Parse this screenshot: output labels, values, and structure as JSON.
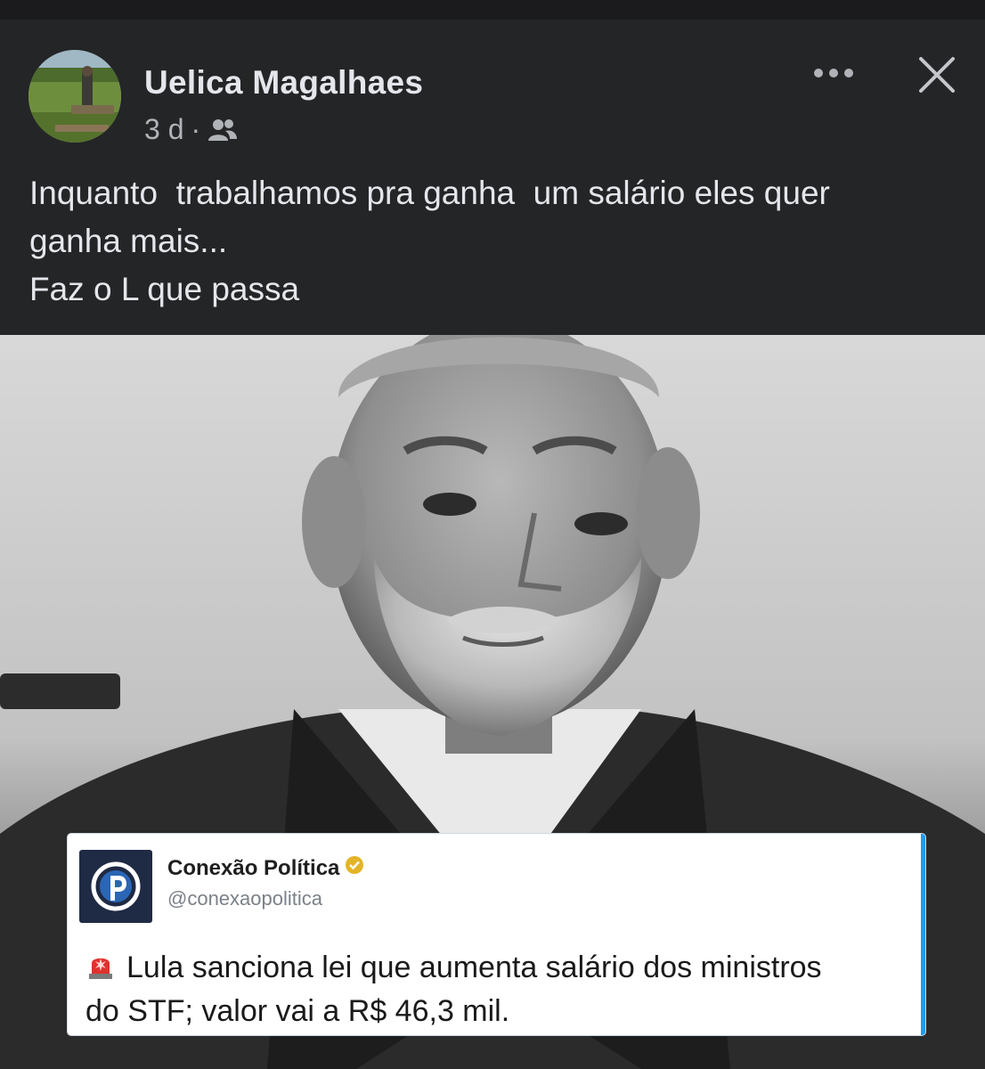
{
  "post": {
    "author": "Uelica Magalhaes",
    "time": "3 d",
    "separator": "·",
    "audience_icon": "friends-icon",
    "more_icon": "more-horizontal-icon",
    "close_icon": "close-icon",
    "text_lines": [
      "Inquanto  trabalhamos pra ganha  um salário eles quer",
      "ganha mais...",
      "Faz o L que passa"
    ]
  },
  "embedded_tweet": {
    "account_name": "Conexão Política",
    "handle": "@conexaopolitica",
    "verified_icon": "verified-badge-icon",
    "alert_icon": "siren-icon",
    "text_lines": [
      "Lula sanciona lei que aumenta salário dos ministros",
      "do STF; valor vai a R$ 46,3 mil."
    ]
  },
  "colors": {
    "card_bg": "#242526",
    "text_primary": "#e4e6eb",
    "text_secondary": "#b0b3b8",
    "tweet_border": "#1d9bf0",
    "tweet_logo_bg": "#1f2a44"
  }
}
